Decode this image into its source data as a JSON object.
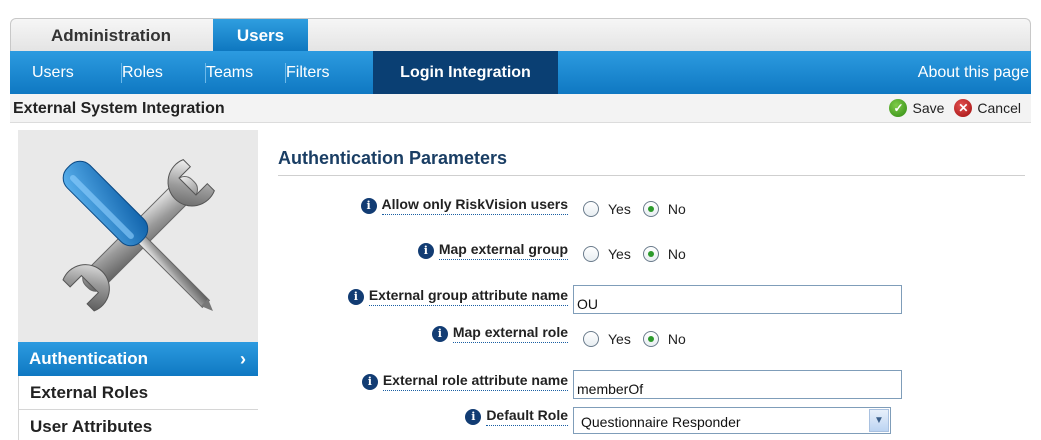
{
  "top_tabs": [
    {
      "label": "Administration"
    },
    {
      "label": "Users"
    }
  ],
  "sub_tabs": [
    {
      "label": "Users"
    },
    {
      "label": "Roles"
    },
    {
      "label": "Teams"
    },
    {
      "label": "Filters"
    },
    {
      "label": "Login Integration"
    }
  ],
  "about_link": "About this page",
  "header": {
    "title": "External System Integration",
    "save_label": "Save",
    "cancel_label": "Cancel"
  },
  "sidebar": {
    "items": [
      {
        "label": "Authentication",
        "active": true
      },
      {
        "label": "External Roles"
      },
      {
        "label": "User Attributes"
      }
    ]
  },
  "section": {
    "title": "Authentication Parameters"
  },
  "form": {
    "allow_only_riskvision": {
      "label": "Allow only RiskVision users",
      "yes": "Yes",
      "no": "No",
      "value": "No"
    },
    "map_external_group": {
      "label": "Map external group",
      "yes": "Yes",
      "no": "No",
      "value": "No"
    },
    "external_group_attr": {
      "label": "External group attribute name",
      "value": "OU"
    },
    "map_external_role": {
      "label": "Map external role",
      "yes": "Yes",
      "no": "No",
      "value": "No"
    },
    "external_role_attr": {
      "label": "External role attribute name",
      "value": "memberOf"
    },
    "default_role": {
      "label": "Default Role",
      "value": "Questionnaire Responder"
    }
  },
  "icons": {
    "info": "info-icon",
    "save": "check-circle-icon",
    "cancel": "x-circle-icon"
  },
  "colors": {
    "nav_blue": "#0f78c2",
    "active_nav": "#0a3f73",
    "section_title": "#1a3e64"
  }
}
